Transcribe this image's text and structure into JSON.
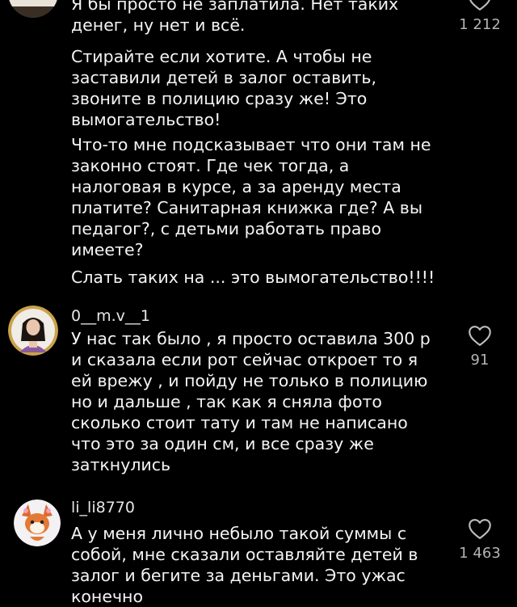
{
  "comments": [
    {
      "username": "",
      "paragraphs": [
        "Я бы просто не заплатила. Нет таких\nденег, ну нет и всё.",
        "Стирайте если хотите. А чтобы не\nзаставили детей в залог оставить,\nзвоните в полицию сразу же! Это\nвымогательство!",
        "Что-то мне подсказывает что они там не\nзаконно стоят. Где чек тогда, а\nналоговая в курсе, а за аренду места\nплатите? Санитарная книжка где? А вы\nпедагог?, с детьми работать право\nимеете?",
        "Слать таких на ... это вымогательство!!!!"
      ],
      "likes": "1 212",
      "icon": "heart-outline-icon"
    },
    {
      "username": "0__m.v__1",
      "paragraphs": [
        "У нас так было , я просто оставила 300 р\nи сказала если рот сейчас откроет то я\nей врежу , и пойду не только в полицию\nно и дальше , так как я сняла фото\nсколько стоит тату и там не написано\nчто это за один см, и все сразу же\nзаткнулись"
      ],
      "likes": "91",
      "icon": "heart-outline-icon"
    },
    {
      "username": "li_li8770",
      "paragraphs": [
        "А у меня лично небыло такой суммы с\nсобой, мне сказали оставляйте детей в\nзалог и бегите за деньгами. Это ужас\nконечно"
      ],
      "likes": "1 463",
      "icon": "heart-outline-icon"
    }
  ],
  "colors": {
    "background": "#000000",
    "text": "#f4f4f4",
    "muted": "#b4b4b4"
  }
}
